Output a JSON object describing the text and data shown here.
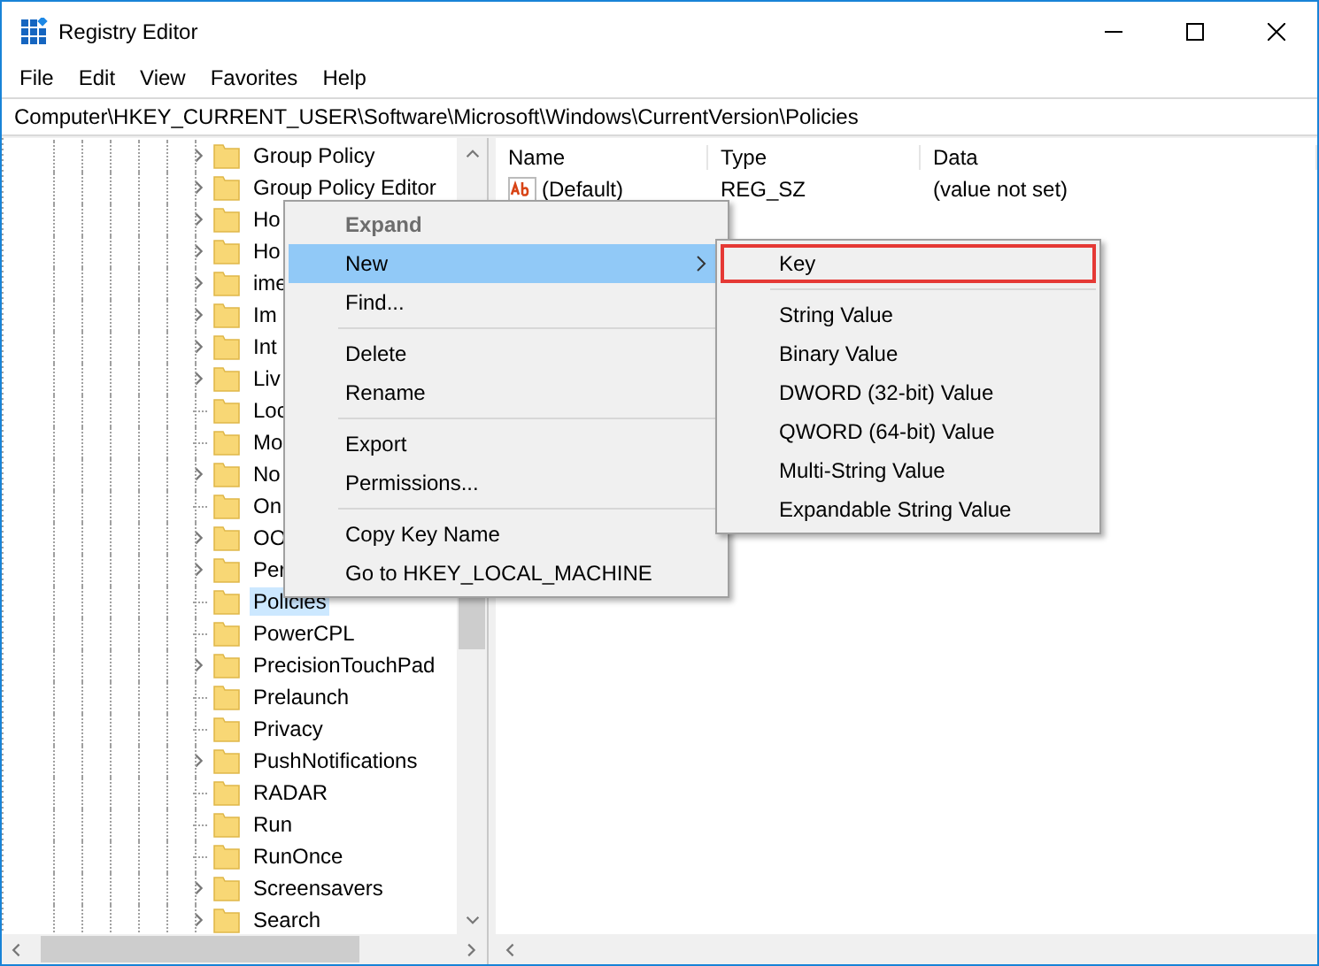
{
  "window": {
    "title": "Registry Editor"
  },
  "menu_bar": [
    "File",
    "Edit",
    "View",
    "Favorites",
    "Help"
  ],
  "address": "Computer\\HKEY_CURRENT_USER\\Software\\Microsoft\\Windows\\CurrentVersion\\Policies",
  "tree": [
    {
      "label": "Group Policy",
      "expandable": true,
      "selected": false
    },
    {
      "label": "Group Policy Editor",
      "expandable": true,
      "selected": false
    },
    {
      "label": "Ho",
      "expandable": true,
      "selected": false
    },
    {
      "label": "Ho",
      "expandable": true,
      "selected": false
    },
    {
      "label": "ime",
      "expandable": true,
      "selected": false
    },
    {
      "label": "Im",
      "expandable": true,
      "selected": false
    },
    {
      "label": "Int",
      "expandable": true,
      "selected": false
    },
    {
      "label": "Liv",
      "expandable": true,
      "selected": false
    },
    {
      "label": "Loc",
      "expandable": false,
      "selected": false
    },
    {
      "label": "Mo",
      "expandable": false,
      "selected": false
    },
    {
      "label": "No",
      "expandable": true,
      "selected": false
    },
    {
      "label": "On",
      "expandable": false,
      "selected": false
    },
    {
      "label": "OO",
      "expandable": true,
      "selected": false
    },
    {
      "label": "Per",
      "expandable": true,
      "selected": false
    },
    {
      "label": "Policies",
      "expandable": false,
      "selected": true
    },
    {
      "label": "PowerCPL",
      "expandable": false,
      "selected": false
    },
    {
      "label": "PrecisionTouchPad",
      "expandable": true,
      "selected": false
    },
    {
      "label": "Prelaunch",
      "expandable": false,
      "selected": false
    },
    {
      "label": "Privacy",
      "expandable": false,
      "selected": false
    },
    {
      "label": "PushNotifications",
      "expandable": true,
      "selected": false
    },
    {
      "label": "RADAR",
      "expandable": false,
      "selected": false
    },
    {
      "label": "Run",
      "expandable": false,
      "selected": false
    },
    {
      "label": "RunOnce",
      "expandable": false,
      "selected": false
    },
    {
      "label": "Screensavers",
      "expandable": true,
      "selected": false
    },
    {
      "label": "Search",
      "expandable": true,
      "selected": false
    }
  ],
  "values_table": {
    "columns": [
      "Name",
      "Type",
      "Data"
    ],
    "rows": [
      {
        "name": "(Default)",
        "type": "REG_SZ",
        "data": "(value not set)"
      }
    ]
  },
  "context_menu": {
    "groups": [
      [
        {
          "label": "Expand",
          "disabled": true,
          "selected": false,
          "submenu": false
        },
        {
          "label": "New",
          "disabled": false,
          "selected": true,
          "submenu": true
        },
        {
          "label": "Find...",
          "disabled": false,
          "selected": false,
          "submenu": false
        }
      ],
      [
        {
          "label": "Delete",
          "disabled": false,
          "selected": false,
          "submenu": false
        },
        {
          "label": "Rename",
          "disabled": false,
          "selected": false,
          "submenu": false
        }
      ],
      [
        {
          "label": "Export",
          "disabled": false,
          "selected": false,
          "submenu": false
        },
        {
          "label": "Permissions...",
          "disabled": false,
          "selected": false,
          "submenu": false
        }
      ],
      [
        {
          "label": "Copy Key Name",
          "disabled": false,
          "selected": false,
          "submenu": false
        },
        {
          "label": "Go to HKEY_LOCAL_MACHINE",
          "disabled": false,
          "selected": false,
          "submenu": false
        }
      ]
    ]
  },
  "submenu": {
    "groups": [
      [
        {
          "label": "Key",
          "highlighted": true
        }
      ],
      [
        {
          "label": "String Value",
          "highlighted": false
        },
        {
          "label": "Binary Value",
          "highlighted": false
        },
        {
          "label": "DWORD (32-bit) Value",
          "highlighted": false
        },
        {
          "label": "QWORD (64-bit) Value",
          "highlighted": false
        },
        {
          "label": "Multi-String Value",
          "highlighted": false
        },
        {
          "label": "Expandable String Value",
          "highlighted": false
        }
      ]
    ]
  }
}
